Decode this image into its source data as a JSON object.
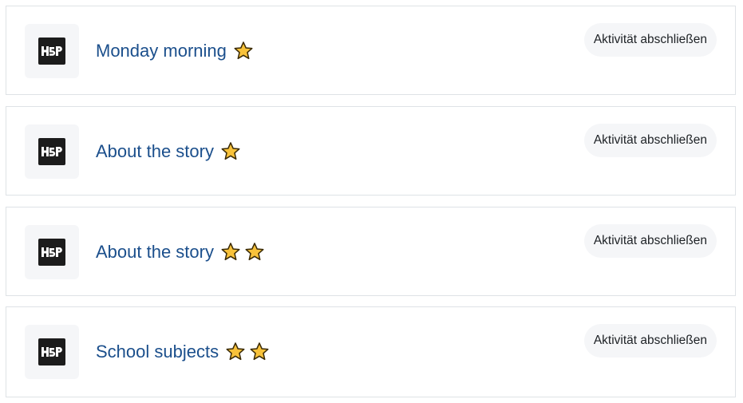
{
  "activities": [
    {
      "title": "Monday morning",
      "stars": 1,
      "button_label": "Aktivität abschließen",
      "icon": "h5p-icon",
      "logo_text": "H5P"
    },
    {
      "title": "About the story",
      "stars": 1,
      "button_label": "Aktivität abschließen",
      "icon": "h5p-icon",
      "logo_text": "H5P"
    },
    {
      "title": "About the story",
      "stars": 2,
      "button_label": "Aktivität abschließen",
      "icon": "h5p-icon",
      "logo_text": "H5P"
    },
    {
      "title": "School subjects",
      "stars": 2,
      "button_label": "Aktivität abschließen",
      "icon": "h5p-icon",
      "logo_text": "H5P"
    }
  ],
  "colors": {
    "title": "#1b4f8c",
    "star_fill": "#f8c23a",
    "star_stroke": "#3a2a05",
    "button_bg": "#f5f6f8",
    "card_border": "#dee2e6"
  }
}
